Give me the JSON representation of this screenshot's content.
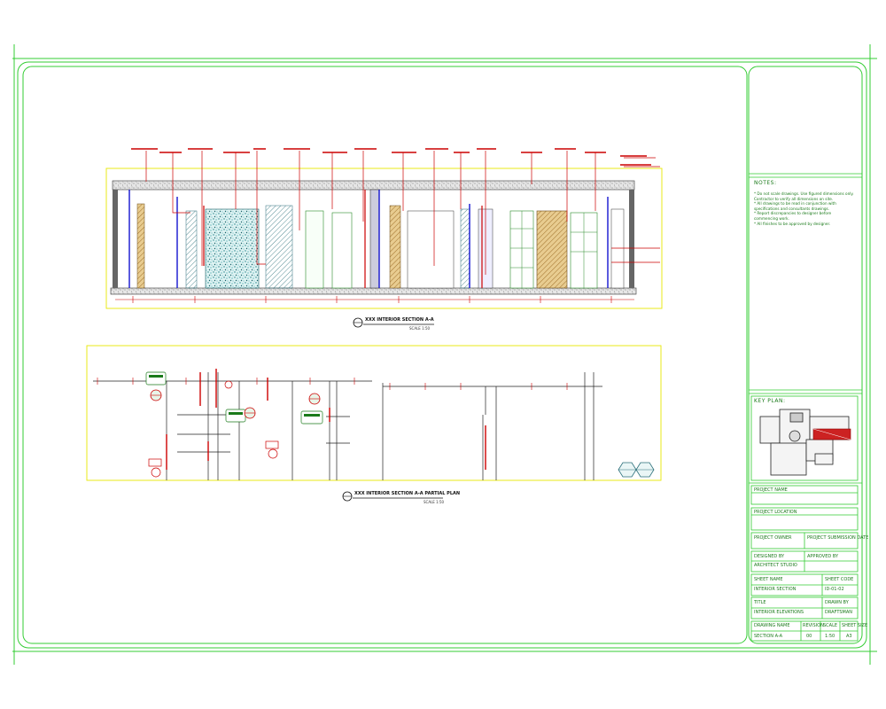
{
  "notes": {
    "heading": "NOTES:",
    "lines": [
      "* Do not scale drawings. Use figured dimensions only.",
      "  Contractor to verify all dimensions on site.",
      "* All drawings to be read in conjunction with",
      "  specifications and consultants drawings.",
      "* Report discrepancies to designer before",
      "  commencing work.",
      "* All finishes to be approved by designer."
    ]
  },
  "key_plan": {
    "heading": "KEY PLAN:"
  },
  "title_block": {
    "row1_label": "PROJECT NAME",
    "row2_label": "PROJECT LOCATION",
    "row3_left": "PROJECT OWNER",
    "row3_right": "PROJECT SUBMISSION DATE",
    "row4_left_label": "DESIGNED BY",
    "row4_left_value": "ARCHITECT STUDIO",
    "row4_right_label": "APPROVED BY",
    "row5_left_label": "SHEET NAME",
    "row5_left_value": "INTERIOR SECTION",
    "row5_right_label": "SHEET CODE",
    "row5_right_value": "ID-01-02",
    "row6_left_label": "TITLE",
    "row6_left_value": "INTERIOR ELEVATIONS",
    "row6_right_label": "DRAWN BY",
    "row6_right_value": "DRAFTSMAN",
    "row7_labels": [
      "DRAWING NAME",
      "REVISION",
      "SCALE",
      "SHEET SIZE"
    ],
    "row7_values": [
      "SECTION A-A",
      "00",
      "1:50",
      "A3"
    ]
  },
  "drawings": {
    "top_title": "XXX INTERIOR SECTION A-A",
    "top_scale": "SCALE 1:50",
    "bottom_title": "XXX INTERIOR SECTION A-A PARTIAL PLAN",
    "bottom_scale": "SCALE 1:50"
  },
  "colors": {
    "frame": "#33cc33",
    "tb_text": "#1a7a1a",
    "viewport": "#e8e800",
    "red_line": "#cc0000",
    "blue_line": "#0000cc",
    "hatch": "#2a6f7a",
    "wood": "#b08030"
  }
}
